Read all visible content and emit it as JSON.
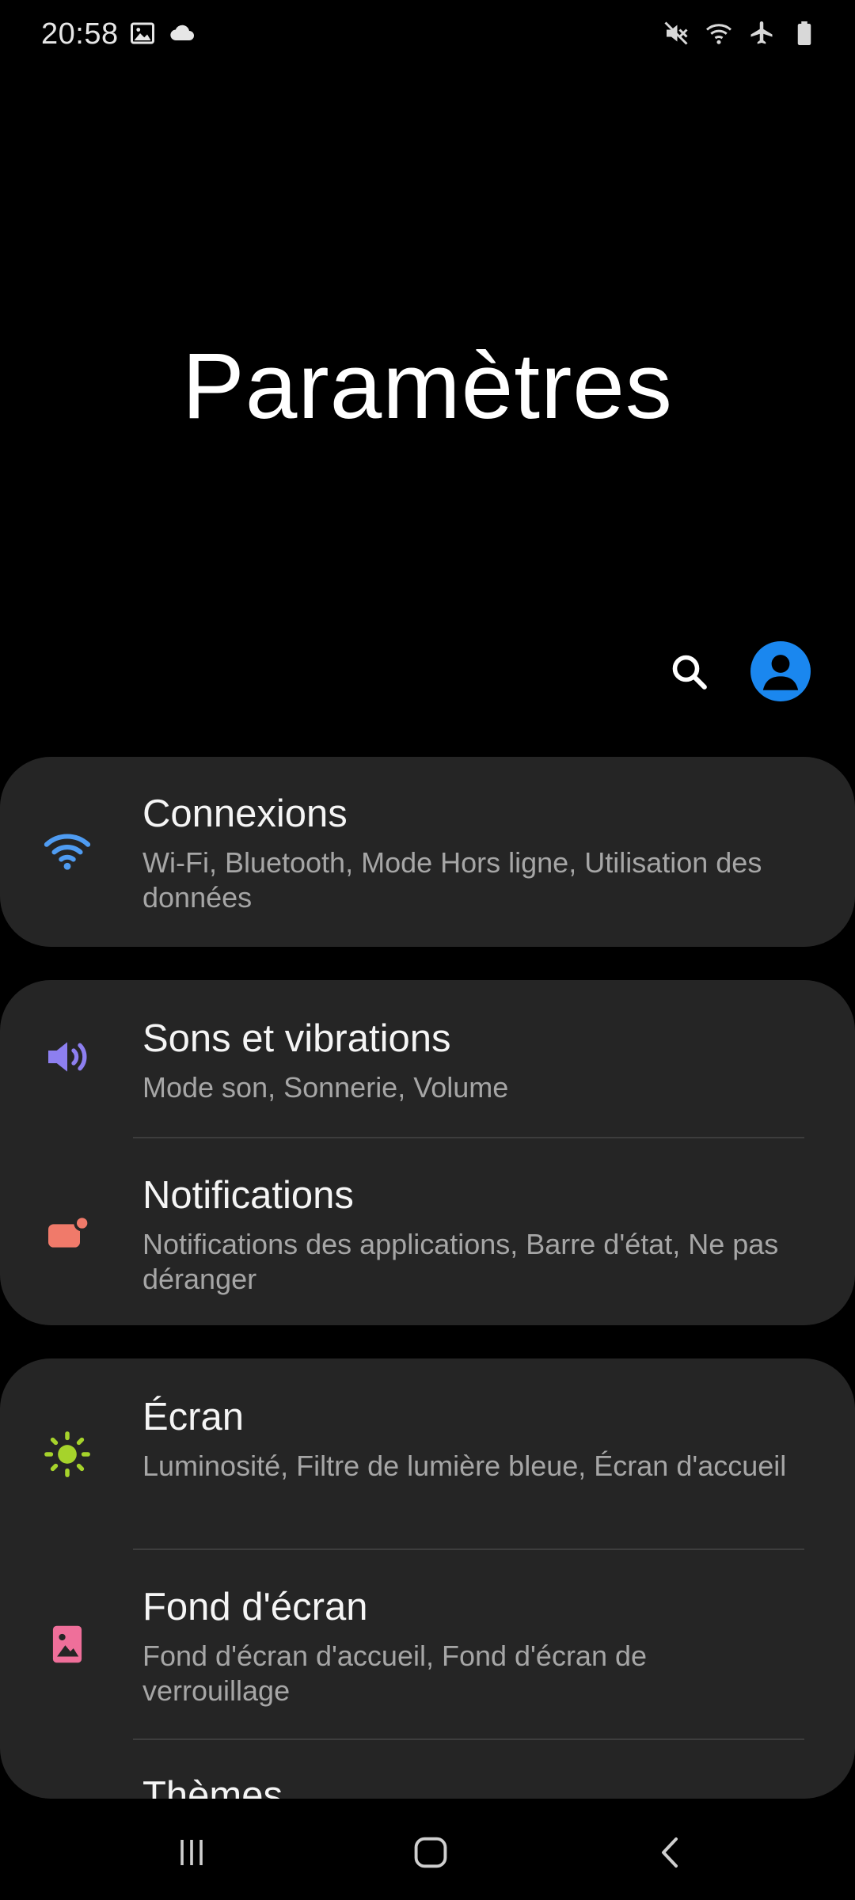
{
  "status_bar": {
    "time": "20:58",
    "left_icons": [
      "image-icon",
      "cloud-icon"
    ],
    "right_icons": [
      "mute-icon",
      "wifi-icon",
      "airplane-mode-icon",
      "battery-icon"
    ]
  },
  "header": {
    "title": "Paramètres",
    "search_icon": "search-icon",
    "account_icon": "account-icon",
    "accent_color": "#1a87ef"
  },
  "settings": [
    {
      "title": "Connexions",
      "subtitle": "Wi-Fi, Bluetooth, Mode Hors ligne, Utilisation des données",
      "icon": "wifi-icon",
      "icon_color": "#4f9cf2"
    },
    {
      "title": "Sons et vibrations",
      "subtitle": "Mode son, Sonnerie, Volume",
      "icon": "volume-icon",
      "icon_color": "#8d7ff0"
    },
    {
      "title": "Notifications",
      "subtitle": "Notifications des applications, Barre d'état, Ne pas déranger",
      "icon": "notifications-icon",
      "icon_color": "#f07a6a"
    },
    {
      "title": "Écran",
      "subtitle": "Luminosité, Filtre de lumière bleue, Écran d'accueil",
      "icon": "brightness-icon",
      "icon_color": "#a6d32b"
    },
    {
      "title": "Fond d'écran",
      "subtitle": "Fond d'écran d'accueil, Fond d'écran de verrouillage",
      "icon": "wallpaper-icon",
      "icon_color": "#ef6f9a"
    },
    {
      "title": "Thèmes",
      "icon": "themes-icon"
    }
  ],
  "nav_bar": {
    "recents_icon": "recents-icon",
    "home_icon": "home-icon",
    "back_icon": "back-icon"
  }
}
